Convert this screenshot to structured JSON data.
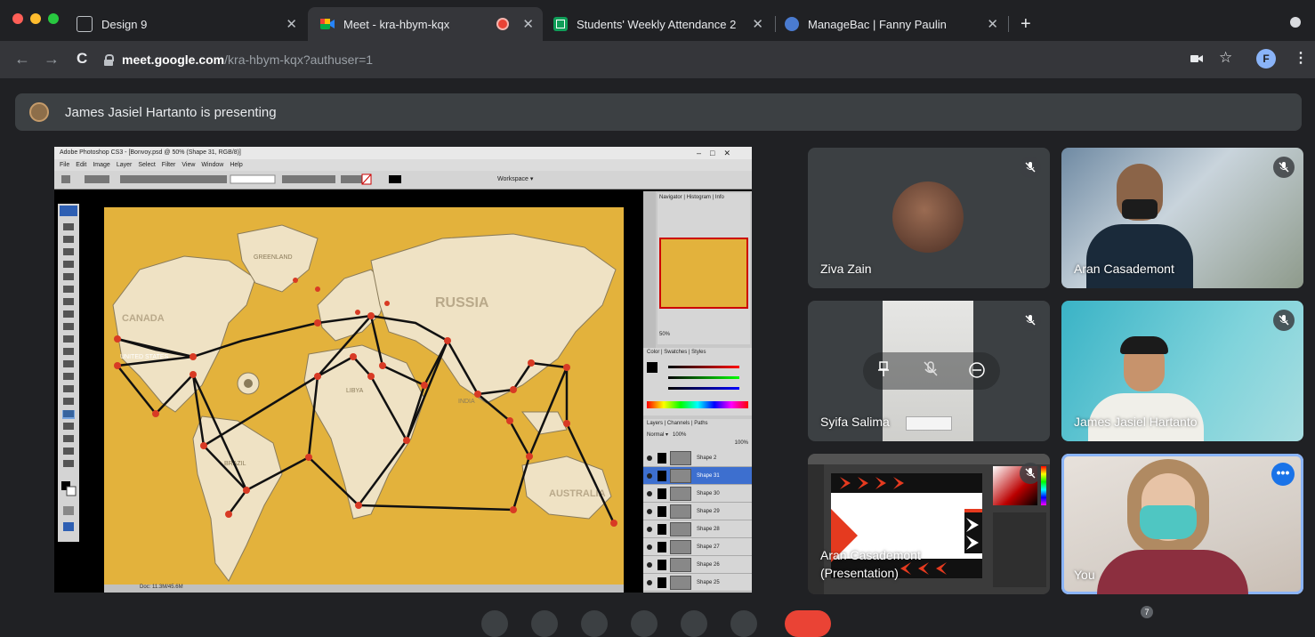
{
  "browser": {
    "tabs": [
      {
        "label": "Design 9",
        "icon": "slides-icon",
        "active": false
      },
      {
        "label": "Meet - kra-hbym-kqx",
        "icon": "meet-icon",
        "active": true,
        "recording_indicator": true
      },
      {
        "label": "Students' Weekly Attendance 2",
        "icon": "sheets-icon",
        "active": false
      },
      {
        "label": "ManageBac | Fanny Paulin",
        "icon": "managebac-icon",
        "active": false
      }
    ],
    "url_host": "meet.google.com",
    "url_path": "/kra-hbym-kqx?authuser=1",
    "profile_initial": "F",
    "colors": {
      "tab_bg": "#202124",
      "toolbar_bg": "#35363a",
      "accent": "#8ab4f8"
    }
  },
  "meet": {
    "presenting_text": "James Jasiel Hartanto is presenting",
    "shared_screen": {
      "app_title": "Adobe Photoshop CS3 - [Bonvoy.psd @ 50% (Shape 31, RGB/8)]",
      "menu": [
        "File",
        "Edit",
        "Image",
        "Layer",
        "Select",
        "Filter",
        "View",
        "Window",
        "Help"
      ],
      "map_labels": [
        "GREENLAND",
        "CANADA",
        "RUSSIA",
        "UNITED STATES",
        "BRAZIL",
        "LIBYA",
        "INDIA",
        "AUSTRALIA"
      ],
      "layers": [
        "Shape 2",
        "Shape 31",
        "Shape 30",
        "Shape 29",
        "Shape 28",
        "Shape 27",
        "Shape 26",
        "Shape 25"
      ],
      "panel_tabs": {
        "navigator": "Navigator",
        "histogram": "Histogram",
        "info": "Info",
        "color": "Color",
        "swatches": "Swatches",
        "styles": "Styles",
        "layers": "Layers",
        "channels": "Channels",
        "paths": "Paths"
      },
      "zoom": "50%",
      "workspace_label": "Workspace",
      "blend_mode": "Normal",
      "opacity": "100%",
      "fill": "100%",
      "status_doc": "Doc: 11.3M/45.6M"
    },
    "participants": [
      {
        "name": "Ziva Zain",
        "muted": true,
        "video": "avatar"
      },
      {
        "name": "Aran Casademont",
        "muted": true,
        "video": "camera"
      },
      {
        "name": "Syifa Salima",
        "muted": true,
        "video": "camera"
      },
      {
        "name": "James Jasiel Hartanto",
        "muted": true,
        "video": "camera"
      },
      {
        "name": "Aran Casademont (Presentation)",
        "muted": true,
        "video": "screen"
      },
      {
        "name": "You",
        "muted": false,
        "video": "camera"
      }
    ],
    "participant_count": "7",
    "colors": {
      "tile_bg": "#3c4043",
      "self_border": "#8ab4f8",
      "end_call": "#ea4335",
      "map_yellow": "#e3b23c"
    }
  }
}
